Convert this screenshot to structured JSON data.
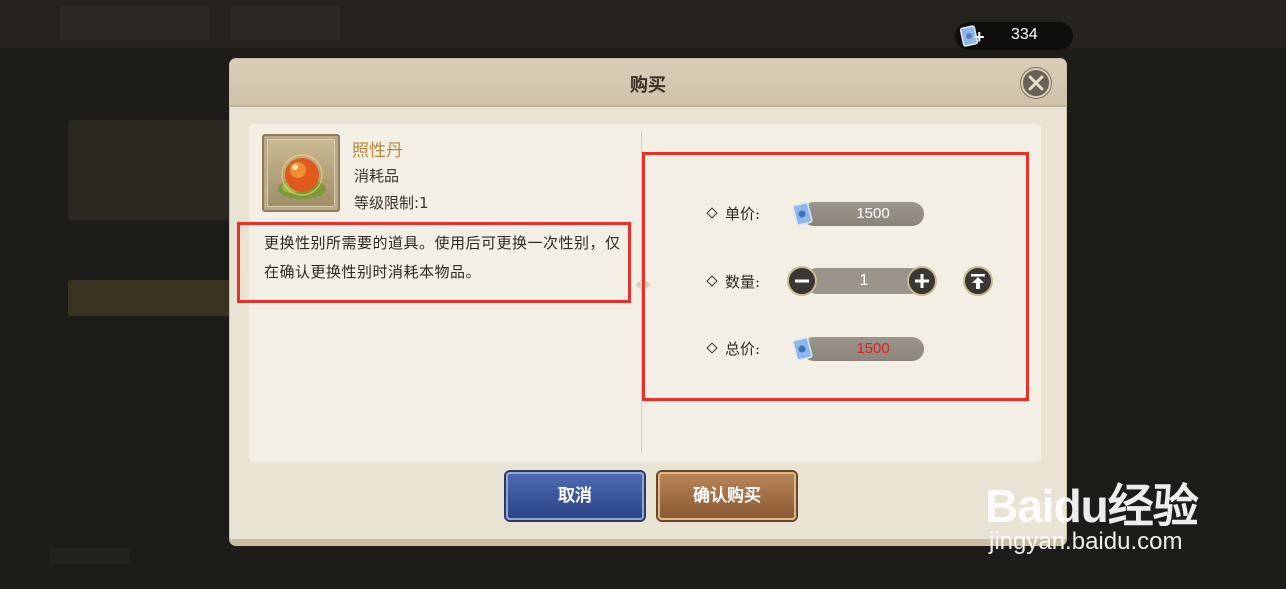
{
  "currency": {
    "icon": "ticket-plus-icon",
    "amount": "334"
  },
  "dialog": {
    "title": "购买",
    "close_icon": "close-icon"
  },
  "item": {
    "icon": "elixir-orb-icon",
    "name": "照性丹",
    "type": "消耗品",
    "level_limit": "等级限制:1",
    "description": "更换性别所需要的道具。使用后可更换一次性别，仅在确认更换性别时消耗本物品。"
  },
  "purchase": {
    "unit_price_label": "单价:",
    "unit_price": "1500",
    "quantity_label": "数量:",
    "quantity": "1",
    "total_label": "总价:",
    "total_price": "1500",
    "total_color": "#d8231e"
  },
  "buttons": {
    "cancel": "取消",
    "confirm": "确认购买"
  },
  "watermark": {
    "logo": "Baidu经验",
    "url": "jingyan.baidu.com"
  },
  "colors": {
    "highlight_box": "#e6302b",
    "cancel_button": "#3a55a0",
    "confirm_button": "#a66f45",
    "item_name": "#b48a3e"
  }
}
